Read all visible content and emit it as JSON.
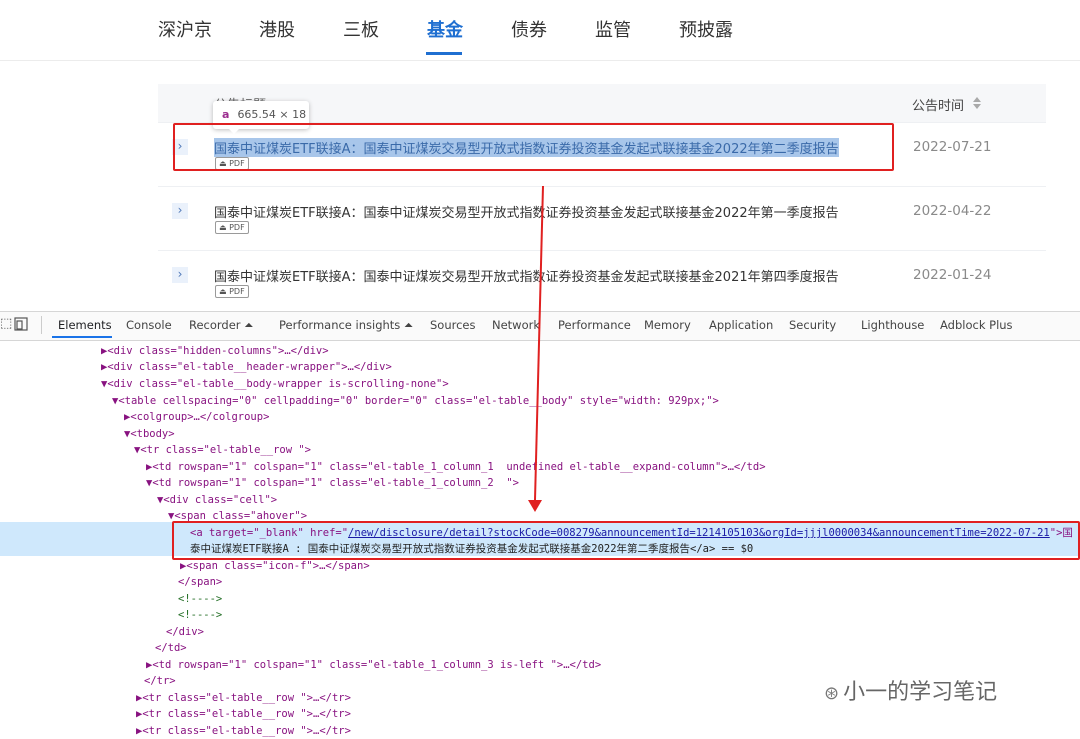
{
  "nav": {
    "tabs": [
      {
        "label": "深沪京"
      },
      {
        "label": "港股"
      },
      {
        "label": "三板"
      },
      {
        "label": "基金",
        "active": true
      },
      {
        "label": "债券"
      },
      {
        "label": "监管"
      },
      {
        "label": "预披露"
      }
    ],
    "accent_color": "#1f6fd1"
  },
  "table": {
    "col_title": "公告标题",
    "col_time": "公告时间",
    "rows": [
      {
        "title": "国泰中证煤炭ETF联接A：国泰中证煤炭交易型开放式指数证券投资基金发起式联接基金2022年第二季度报告",
        "badge": "PDF",
        "date": "2022-07-21"
      },
      {
        "title": "国泰中证煤炭ETF联接A：国泰中证煤炭交易型开放式指数证券投资基金发起式联接基金2022年第一季度报告",
        "badge": "PDF",
        "date": "2022-04-22"
      },
      {
        "title": "国泰中证煤炭ETF联接A：国泰中证煤炭交易型开放式指数证券投资基金发起式联接基金2021年第四季度报告",
        "badge": "PDF",
        "date": "2022-01-24"
      }
    ],
    "expand_icon": "›"
  },
  "tooltip": {
    "tag": "a",
    "size": "665.54 × 18"
  },
  "devtools": {
    "tabs": [
      "Elements",
      "Console",
      "Recorder ⏶",
      "Performance insights ⏶",
      "Sources",
      "Network",
      "Performance",
      "Memory",
      "Application",
      "Security",
      "Lighthouse",
      "Adblock Plus"
    ],
    "active_tab": "Elements",
    "lines": {
      "l1": "▶<div class=\"hidden-columns\">…</div>",
      "l2": "▶<div class=\"el-table__header-wrapper\">…</div>",
      "l3": "▼<div class=\"el-table__body-wrapper is-scrolling-none\">",
      "l4": "▼<table cellspacing=\"0\" cellpadding=\"0\" border=\"0\" class=\"el-table__body\" style=\"width: 929px;\">",
      "l5": "▶<colgroup>…</colgroup>",
      "l6": "▼<tbody>",
      "l7": "▼<tr class=\"el-table__row \">",
      "l8": "▶<td rowspan=\"1\" colspan=\"1\" class=\"el-table_1_column_1  undefined el-table__expand-column\">…</td>",
      "l9": "▼<td rowspan=\"1\" colspan=\"1\" class=\"el-table_1_column_2  \">",
      "l10": "▼<div class=\"cell\">",
      "l11": "▼<span class=\"ahover\">",
      "l12_pre": "<a target=\"_blank\" href=\"",
      "l12_href": "/new/disclosure/detail?stockCode=008279&announcementId=1214105103&orgId=jjjl0000034&announcementTime=2022-07-21",
      "l12_post": "\">国",
      "l13": "泰中证煤炭ETF联接A : 国泰中证煤炭交易型开放式指数证券投资基金发起式联接基金2022年第二季度报告</a> == $0",
      "l14": "▶<span class=\"icon-f\">…</span>",
      "l15": "</span>",
      "l16": "<!---->",
      "l17": "<!---->",
      "l18": "</div>",
      "l19": "</td>",
      "l20": "▶<td rowspan=\"1\" colspan=\"1\" class=\"el-table_1_column_3 is-left \">…</td>",
      "l21": "</tr>",
      "l22": "▶<tr class=\"el-table__row \">…</tr>",
      "l23": "▶<tr class=\"el-table__row \">…</tr>",
      "l24": "▶<tr class=\"el-table__row \">…</tr>"
    }
  },
  "watermark": "小一的学习笔记"
}
